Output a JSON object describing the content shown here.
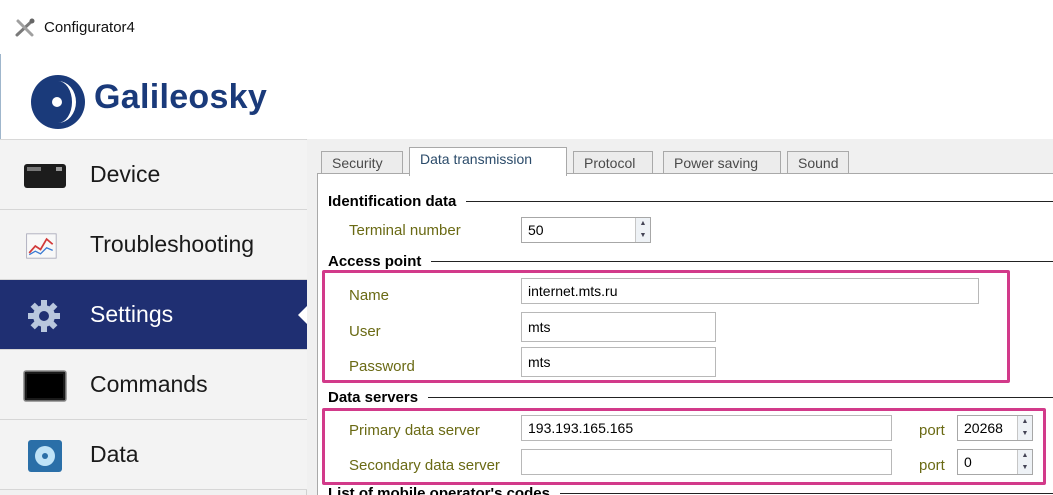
{
  "window": {
    "title": "Configurator4"
  },
  "brand": {
    "name": "Galileosky"
  },
  "sidebar": {
    "items": [
      {
        "label": "Device",
        "icon": "device-icon",
        "active": false
      },
      {
        "label": "Troubleshooting",
        "icon": "chart-icon",
        "active": false
      },
      {
        "label": "Settings",
        "icon": "gear-icon",
        "active": true
      },
      {
        "label": "Commands",
        "icon": "terminal-icon",
        "active": false
      },
      {
        "label": "Data",
        "icon": "disk-icon",
        "active": false
      }
    ]
  },
  "tabs": [
    {
      "label": "Security"
    },
    {
      "label": "Data transmission"
    },
    {
      "label": "Protocol"
    },
    {
      "label": "Power saving"
    },
    {
      "label": "Sound"
    }
  ],
  "identification": {
    "section_title": "Identification data",
    "terminal_number_label": "Terminal number",
    "terminal_number_value": "50"
  },
  "access_point": {
    "section_title": "Access point",
    "name_label": "Name",
    "name_value": "internet.mts.ru",
    "user_label": "User",
    "user_value": "mts",
    "password_label": "Password",
    "password_value": "mts"
  },
  "data_servers": {
    "section_title": "Data servers",
    "primary_label": "Primary data server",
    "primary_value": "193.193.165.165",
    "primary_port_label": "port",
    "primary_port_value": "20268",
    "secondary_label": "Secondary data server",
    "secondary_value": "",
    "secondary_port_label": "port",
    "secondary_port_value": "0"
  },
  "next_section": {
    "section_title": "List of mobile operator's codes"
  },
  "colors": {
    "accent_active": "#1f2f72",
    "highlight": "#d23a8a",
    "field_label": "#6a6a14"
  }
}
